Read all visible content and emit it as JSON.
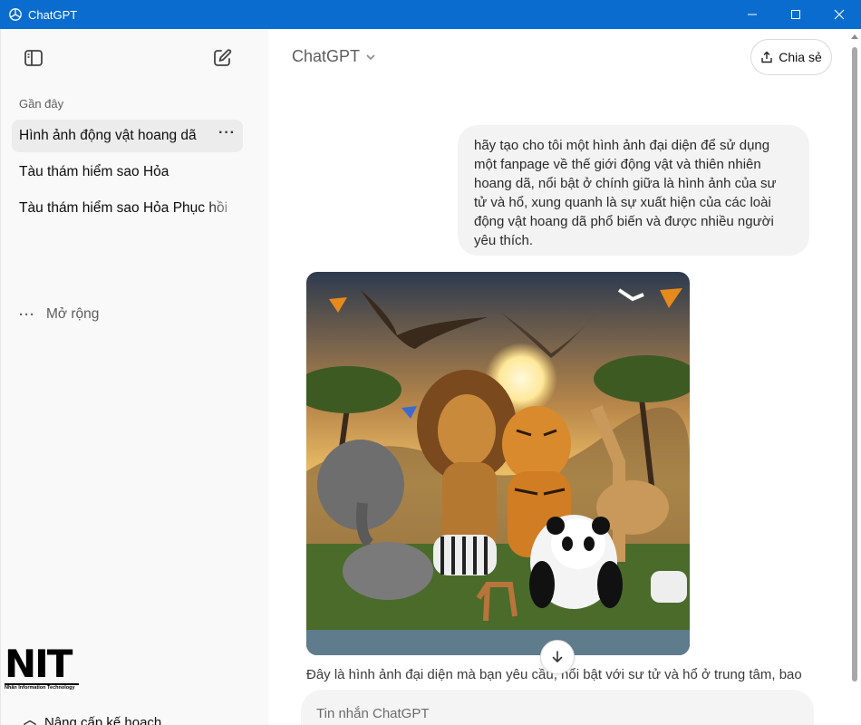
{
  "window": {
    "title": "ChatGPT",
    "app_icon": "openai-logo-icon"
  },
  "sidebar": {
    "toggle_icon": "sidebar-toggle-icon",
    "new_chat_icon": "new-chat-icon",
    "section_label": "Gần đây",
    "items": [
      {
        "label": "Hình ảnh động vật hoang dã",
        "active": true
      },
      {
        "label": "Tàu thám hiểm sao Hỏa",
        "active": false
      },
      {
        "label": "Tàu thám hiểm sao Hỏa Phục hồi",
        "active": false
      }
    ],
    "more_icon": "ellipsis-icon",
    "expand_label": "Mở rộng",
    "logo": {
      "text": "NIT",
      "subtitle": "Nhân Information Technology"
    },
    "upgrade_label": "Nâng cấp kế hoạch"
  },
  "header": {
    "model_name": "ChatGPT",
    "share_label": "Chia sẻ"
  },
  "conversation": {
    "user_message": "hãy tạo cho tôi một hình ảnh đại diện để sử dụng một fanpage về thế giới động vật và thiên nhiên hoang dã, nổi bật ở chính giữa là hình ảnh của sư tử và hổ, xung quanh là sự xuất hiện của các loài động vật hoang dã phổ biến và được nhiều người yêu thích.",
    "image_alt": "wildlife-poster-image",
    "assistant_message": "Đây là hình ảnh đại diện mà bạn yêu cầu, nổi bật với sư tử và hổ ở trung tâm, bao"
  },
  "composer": {
    "placeholder": "Tin nhắn ChatGPT"
  },
  "colors": {
    "titlebar": "#0a6ccf",
    "sidebar_bg": "#f9f9f9",
    "active_item": "#ececec",
    "bubble": "#f3f3f3"
  }
}
